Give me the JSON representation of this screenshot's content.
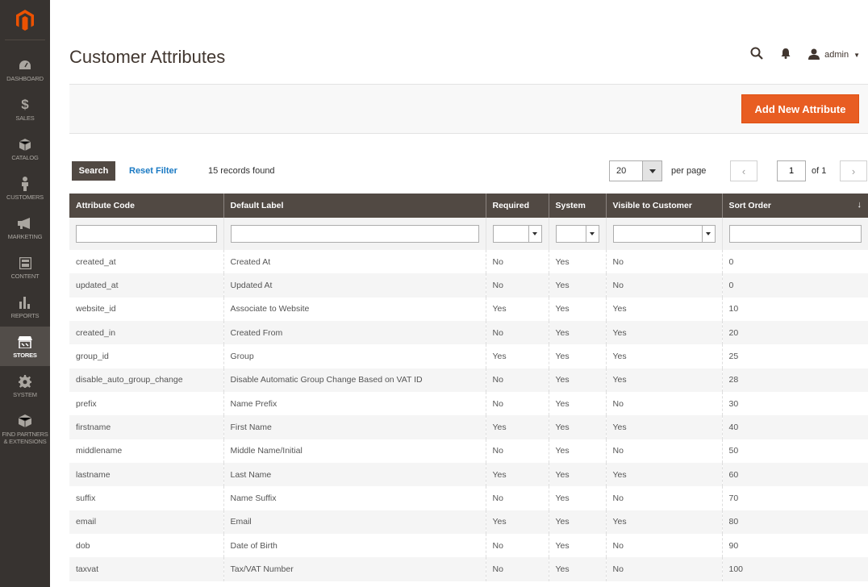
{
  "sidebar": {
    "logo": "magento-logo",
    "items": [
      {
        "label": "DASHBOARD",
        "icon": "dashboard-icon"
      },
      {
        "label": "SALES",
        "icon": "dollar-icon"
      },
      {
        "label": "CATALOG",
        "icon": "box-icon"
      },
      {
        "label": "CUSTOMERS",
        "icon": "person-icon"
      },
      {
        "label": "MARKETING",
        "icon": "megaphone-icon"
      },
      {
        "label": "CONTENT",
        "icon": "content-icon"
      },
      {
        "label": "REPORTS",
        "icon": "bar-chart-icon"
      },
      {
        "label": "STORES",
        "icon": "store-icon",
        "active": true
      },
      {
        "label": "SYSTEM",
        "icon": "gear-icon"
      },
      {
        "label_line1": "FIND PARTNERS",
        "label_line2": "& EXTENSIONS",
        "icon": "partners-icon"
      }
    ]
  },
  "header": {
    "title": "Customer Attributes",
    "user": "admin"
  },
  "actions": {
    "add_label": "Add New Attribute"
  },
  "toolbar": {
    "search_label": "Search",
    "reset_label": "Reset Filter",
    "records": "15 records found",
    "per_page_value": "20",
    "per_page_label": "per page",
    "page_value": "1",
    "page_of": "of 1"
  },
  "grid": {
    "columns": [
      "Attribute Code",
      "Default Label",
      "Required",
      "System",
      "Visible to Customer",
      "Sort Order"
    ],
    "sort_indicator": "↓",
    "rows": [
      [
        "created_at",
        "Created At",
        "No",
        "Yes",
        "No",
        "0"
      ],
      [
        "updated_at",
        "Updated At",
        "No",
        "Yes",
        "No",
        "0"
      ],
      [
        "website_id",
        "Associate to Website",
        "Yes",
        "Yes",
        "Yes",
        "10"
      ],
      [
        "created_in",
        "Created From",
        "No",
        "Yes",
        "Yes",
        "20"
      ],
      [
        "group_id",
        "Group",
        "Yes",
        "Yes",
        "Yes",
        "25"
      ],
      [
        "disable_auto_group_change",
        "Disable Automatic Group Change Based on VAT ID",
        "No",
        "Yes",
        "Yes",
        "28"
      ],
      [
        "prefix",
        "Name Prefix",
        "No",
        "Yes",
        "No",
        "30"
      ],
      [
        "firstname",
        "First Name",
        "Yes",
        "Yes",
        "Yes",
        "40"
      ],
      [
        "middlename",
        "Middle Name/Initial",
        "No",
        "Yes",
        "No",
        "50"
      ],
      [
        "lastname",
        "Last Name",
        "Yes",
        "Yes",
        "Yes",
        "60"
      ],
      [
        "suffix",
        "Name Suffix",
        "No",
        "Yes",
        "No",
        "70"
      ],
      [
        "email",
        "Email",
        "Yes",
        "Yes",
        "Yes",
        "80"
      ],
      [
        "dob",
        "Date of Birth",
        "No",
        "Yes",
        "No",
        "90"
      ],
      [
        "taxvat",
        "Tax/VAT Number",
        "No",
        "Yes",
        "No",
        "100"
      ]
    ]
  },
  "colors": {
    "sidebar_bg": "#373330",
    "header_row_bg": "#514943",
    "accent": "#e85d22",
    "link": "#1979c3"
  }
}
